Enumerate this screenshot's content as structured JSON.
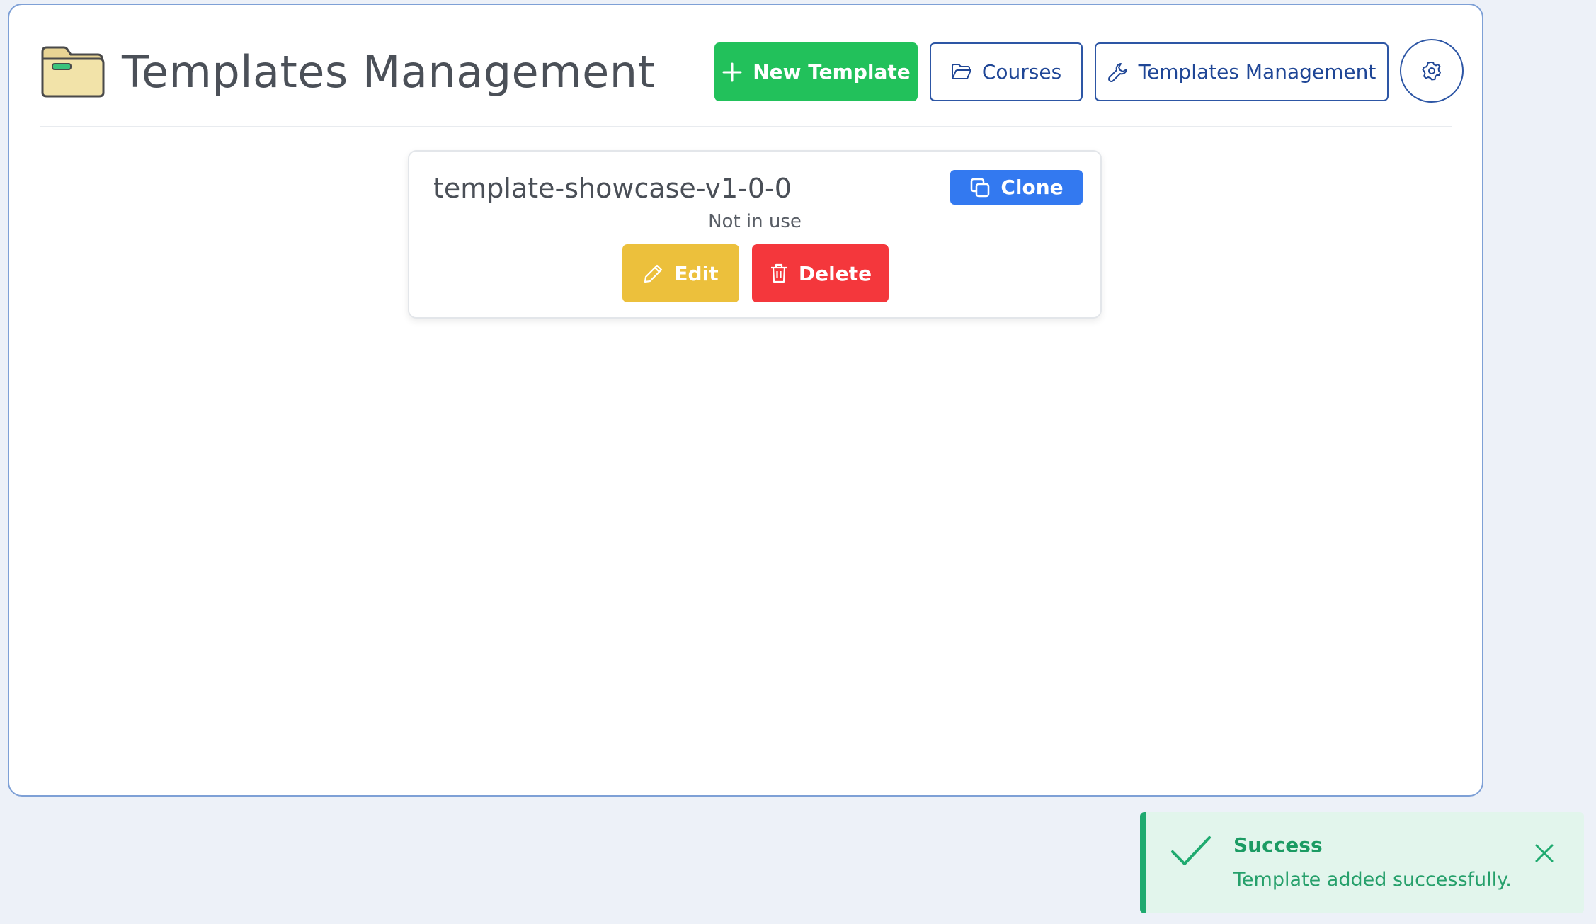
{
  "header": {
    "title": "Templates Management",
    "logo_icon": "folder-icon",
    "buttons": {
      "new_template": "New Template",
      "courses": "Courses",
      "templates_management": "Templates Management"
    },
    "settings_icon": "gear-icon"
  },
  "templates": [
    {
      "name": "template-showcase-v1-0-0",
      "status": "Not in use",
      "clone_label": "Clone",
      "edit_label": "Edit",
      "delete_label": "Delete"
    }
  ],
  "toast": {
    "title": "Success",
    "message": "Template added successfully."
  },
  "colors": {
    "accent_green": "#22c15b",
    "accent_blue": "#3379f0",
    "edit_yellow": "#ecc03c",
    "delete_red": "#f4373c",
    "outline_blue": "#2d56a5",
    "toast_green": "#1faa6f"
  }
}
